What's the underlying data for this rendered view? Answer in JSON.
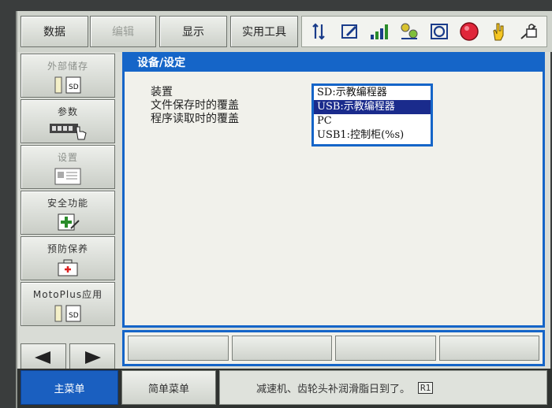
{
  "top_menu": [
    {
      "label": "数据",
      "enabled": true
    },
    {
      "label": "编辑",
      "enabled": false
    },
    {
      "label": "显示",
      "enabled": true
    },
    {
      "label": "实用工具",
      "enabled": true
    }
  ],
  "status_icons": [
    "coordinate-icon",
    "edit-icon",
    "signal-icon",
    "robot-group-icon",
    "cycle-icon",
    "stop-icon",
    "hand-icon",
    "lock-icon"
  ],
  "left_nav": [
    {
      "label": "外部储存",
      "icon": "sd-card-icon",
      "enabled": false
    },
    {
      "label": "参数",
      "icon": "parameter-icon",
      "enabled": true
    },
    {
      "label": "设置",
      "icon": "setup-icon",
      "enabled": false
    },
    {
      "label": "安全功能",
      "icon": "safety-icon",
      "enabled": true
    },
    {
      "label": "预防保养",
      "icon": "toolbox-icon",
      "enabled": true
    },
    {
      "label": "MotoPlus应用",
      "icon": "sd-card-icon",
      "enabled": true
    }
  ],
  "panel": {
    "title": "设备/设定",
    "labels": [
      "装置",
      "文件保存时的覆盖",
      "程序读取时的覆盖"
    ],
    "dropdown_options": [
      "SD:示教编程器",
      "USB:示教编程器",
      "PC",
      "USB1:控制柜(%s)"
    ],
    "selected_index": 1
  },
  "bottom": {
    "main_menu": "主菜单",
    "simple_menu": "简单菜单",
    "message": "减速机、齿轮头补润滑脂日到了。",
    "message_code": "R1"
  }
}
